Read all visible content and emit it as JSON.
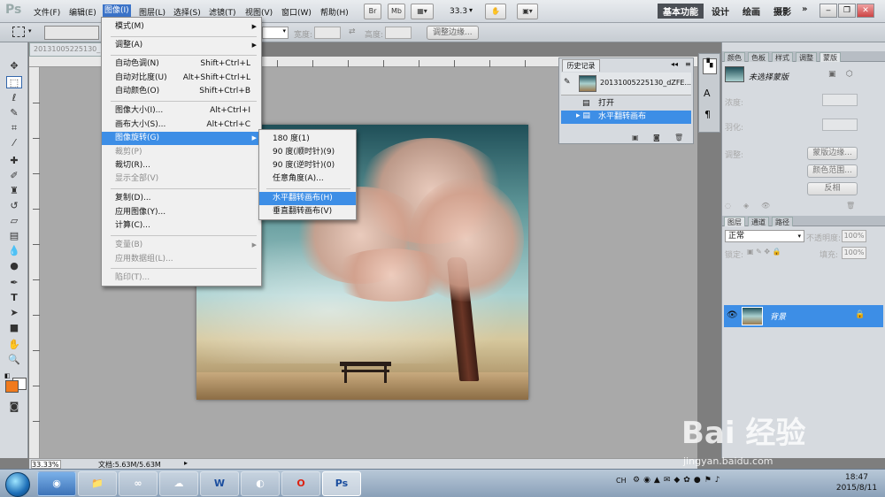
{
  "app": {
    "logo": "Ps",
    "menus": [
      "文件(F)",
      "编辑(E)",
      "图像(I)",
      "图层(L)",
      "选择(S)",
      "滤镜(T)",
      "视图(V)",
      "窗口(W)",
      "帮助(H)"
    ],
    "toolbar_buttons": [
      "Br",
      "Mb"
    ],
    "zoom": "33.3",
    "workspaces": [
      "基本功能",
      "设计",
      "绘画",
      "摄影"
    ],
    "more": "»",
    "window_controls": [
      "‒",
      "❐",
      "✕"
    ]
  },
  "options_bar": {
    "width_label": "宽度:",
    "height_label": "高度:",
    "refine_button": "调整边缘..."
  },
  "document": {
    "tab": "20131005225130_",
    "status_zoom": "33.33%",
    "status_doc": "文档:5.63M/5.63M"
  },
  "image_menu": {
    "items": [
      {
        "label": "模式(M)",
        "shortcut": "",
        "submenu": true,
        "disabled": false
      },
      {
        "label": "调整(A)",
        "shortcut": "",
        "submenu": true,
        "disabled": false
      },
      {
        "label": "自动色调(N)",
        "shortcut": "Shift+Ctrl+L",
        "submenu": false,
        "disabled": false
      },
      {
        "label": "自动对比度(U)",
        "shortcut": "Alt+Shift+Ctrl+L",
        "submenu": false,
        "disabled": false
      },
      {
        "label": "自动颜色(O)",
        "shortcut": "Shift+Ctrl+B",
        "submenu": false,
        "disabled": false
      },
      {
        "label": "图像大小(I)...",
        "shortcut": "Alt+Ctrl+I",
        "submenu": false,
        "disabled": false
      },
      {
        "label": "画布大小(S)...",
        "shortcut": "Alt+Ctrl+C",
        "submenu": false,
        "disabled": false
      },
      {
        "label": "图像旋转(G)",
        "shortcut": "",
        "submenu": true,
        "disabled": false,
        "highlighted": true
      },
      {
        "label": "裁剪(P)",
        "shortcut": "",
        "submenu": false,
        "disabled": true
      },
      {
        "label": "裁切(R)...",
        "shortcut": "",
        "submenu": false,
        "disabled": false
      },
      {
        "label": "显示全部(V)",
        "shortcut": "",
        "submenu": false,
        "disabled": true
      },
      {
        "label": "复制(D)...",
        "shortcut": "",
        "submenu": false,
        "disabled": false
      },
      {
        "label": "应用图像(Y)...",
        "shortcut": "",
        "submenu": false,
        "disabled": false
      },
      {
        "label": "计算(C)...",
        "shortcut": "",
        "submenu": false,
        "disabled": false
      },
      {
        "label": "变量(B)",
        "shortcut": "",
        "submenu": true,
        "disabled": true
      },
      {
        "label": "应用数据组(L)...",
        "shortcut": "",
        "submenu": false,
        "disabled": true
      },
      {
        "label": "陷印(T)...",
        "shortcut": "",
        "submenu": false,
        "disabled": true
      }
    ]
  },
  "rotate_submenu": {
    "items": [
      "180 度(1)",
      "90 度(顺时针)(9)",
      "90 度(逆时针)(0)",
      "任意角度(A)...",
      "水平翻转画布(H)",
      "垂直翻转画布(V)"
    ],
    "highlighted_index": 4
  },
  "history": {
    "tab": "历史记录",
    "snapshot": "20131005225130_dZFE...",
    "rows": [
      "打开",
      "水平翻转画布"
    ]
  },
  "right_panel": {
    "top_tabs": [
      "颜色",
      "色板",
      "样式",
      "调整",
      "蒙版"
    ],
    "mask_title": "未选择蒙版",
    "density_label": "浓度:",
    "feather_label": "羽化:",
    "refine_label": "调整:",
    "mask_buttons": [
      "蒙版边缘...",
      "颜色范围...",
      "反相"
    ],
    "layer_tabs": [
      "图层",
      "通道",
      "路径"
    ],
    "blend_mode": "正常",
    "opacity_label": "不透明度:",
    "opacity_value": "100%",
    "lock_label": "锁定:",
    "fill_label": "填充:",
    "fill_value": "100%",
    "layer_name": "背景"
  },
  "taskbar": {
    "apps": [
      "W",
      "O",
      "Ps"
    ],
    "tray": "CH",
    "time": "18:47",
    "date": "2015/8/11"
  },
  "watermark": {
    "text": "Bai 经验",
    "sub": "jingyan.baidu.com"
  },
  "colors": {
    "highlight": "#3d8ee6",
    "foreground_swatch": "#f07a1d",
    "background_swatch": "#ffffff"
  }
}
